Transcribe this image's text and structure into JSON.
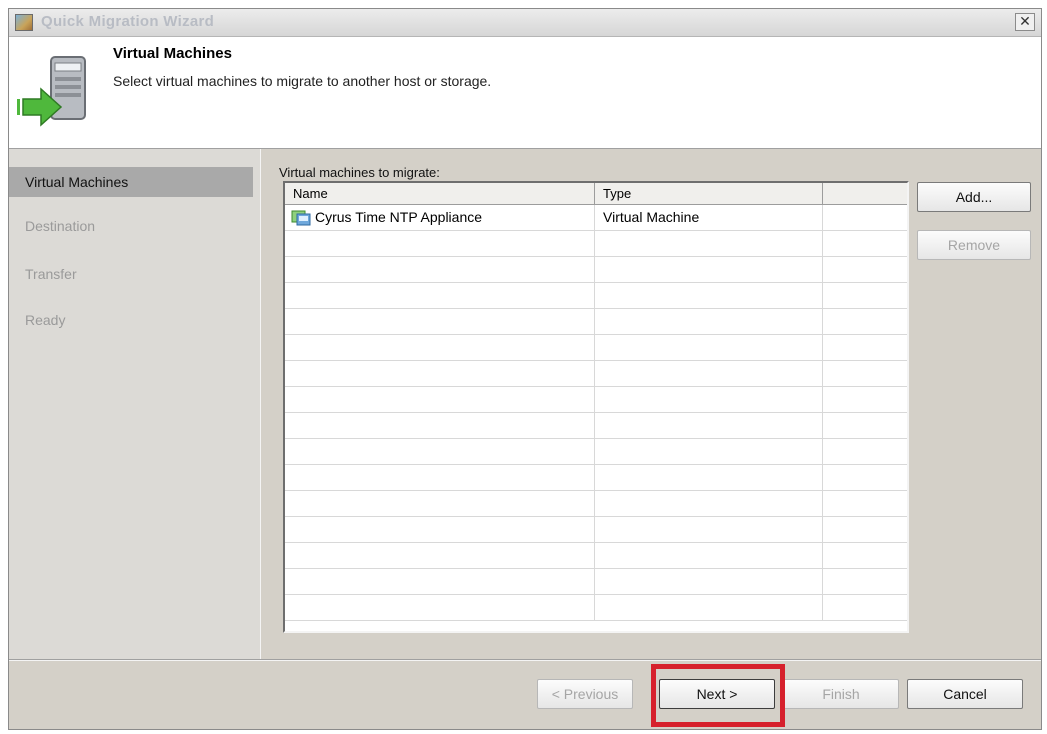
{
  "window": {
    "title": "Quick Migration Wizard",
    "close_glyph": "✕"
  },
  "header": {
    "title": "Virtual Machines",
    "subtitle": "Select virtual machines to migrate to another host or storage.",
    "icon": "migration-server-icon"
  },
  "nav": {
    "items": [
      {
        "label": "Virtual Machines",
        "active": true
      },
      {
        "label": "Destination",
        "active": false
      },
      {
        "label": "Transfer",
        "active": false
      },
      {
        "label": "Ready",
        "active": false
      }
    ]
  },
  "content": {
    "label": "Virtual machines to migrate:",
    "table": {
      "columns": [
        "Name",
        "Type",
        ""
      ],
      "rows": [
        {
          "name": "Cyrus Time NTP Appliance",
          "type": "Virtual Machine",
          "icon": "virtual-machine-icon"
        }
      ]
    },
    "buttons": {
      "add": "Add...",
      "remove": "Remove"
    }
  },
  "footer": {
    "previous": "< Previous",
    "next": "Next >",
    "finish": "Finish",
    "cancel": "Cancel"
  },
  "colors": {
    "highlight": "#d6202c",
    "active_nav": "#a9a9a9"
  }
}
